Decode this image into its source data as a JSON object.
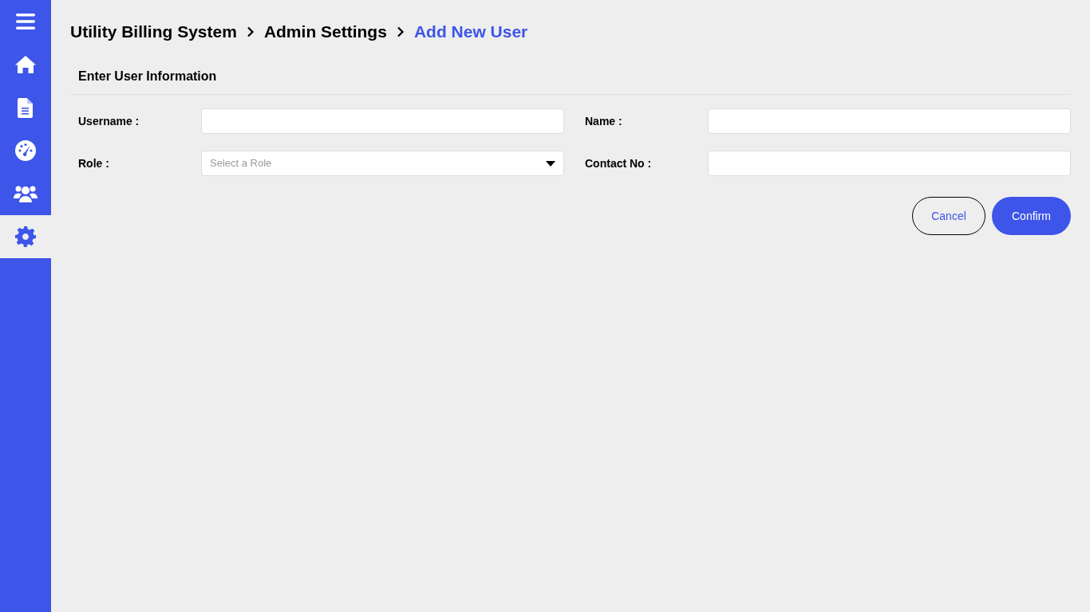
{
  "sidebar": {
    "items": [
      {
        "kind": "menu",
        "selected": false
      },
      {
        "kind": "home",
        "selected": false
      },
      {
        "kind": "document",
        "selected": false
      },
      {
        "kind": "gauge",
        "selected": false
      },
      {
        "kind": "users",
        "selected": false
      },
      {
        "kind": "settings",
        "selected": true
      }
    ]
  },
  "breadcrumb": [
    {
      "label": "Utility Billing System",
      "current": false
    },
    {
      "label": "Admin Settings",
      "current": false
    },
    {
      "label": "Add New User",
      "current": true
    }
  ],
  "section_title": "Enter User Information",
  "fields": [
    {
      "label": "Username :",
      "kind": "text"
    },
    {
      "label": "Name :",
      "kind": "text"
    },
    {
      "label": "Role :",
      "kind": "select",
      "placeholder": "Select a Role"
    },
    {
      "label": "Contact No :",
      "kind": "text"
    }
  ],
  "buttons": [
    {
      "label": "Cancel",
      "kind": "secondary"
    },
    {
      "label": "Confirm",
      "kind": "primary"
    }
  ]
}
